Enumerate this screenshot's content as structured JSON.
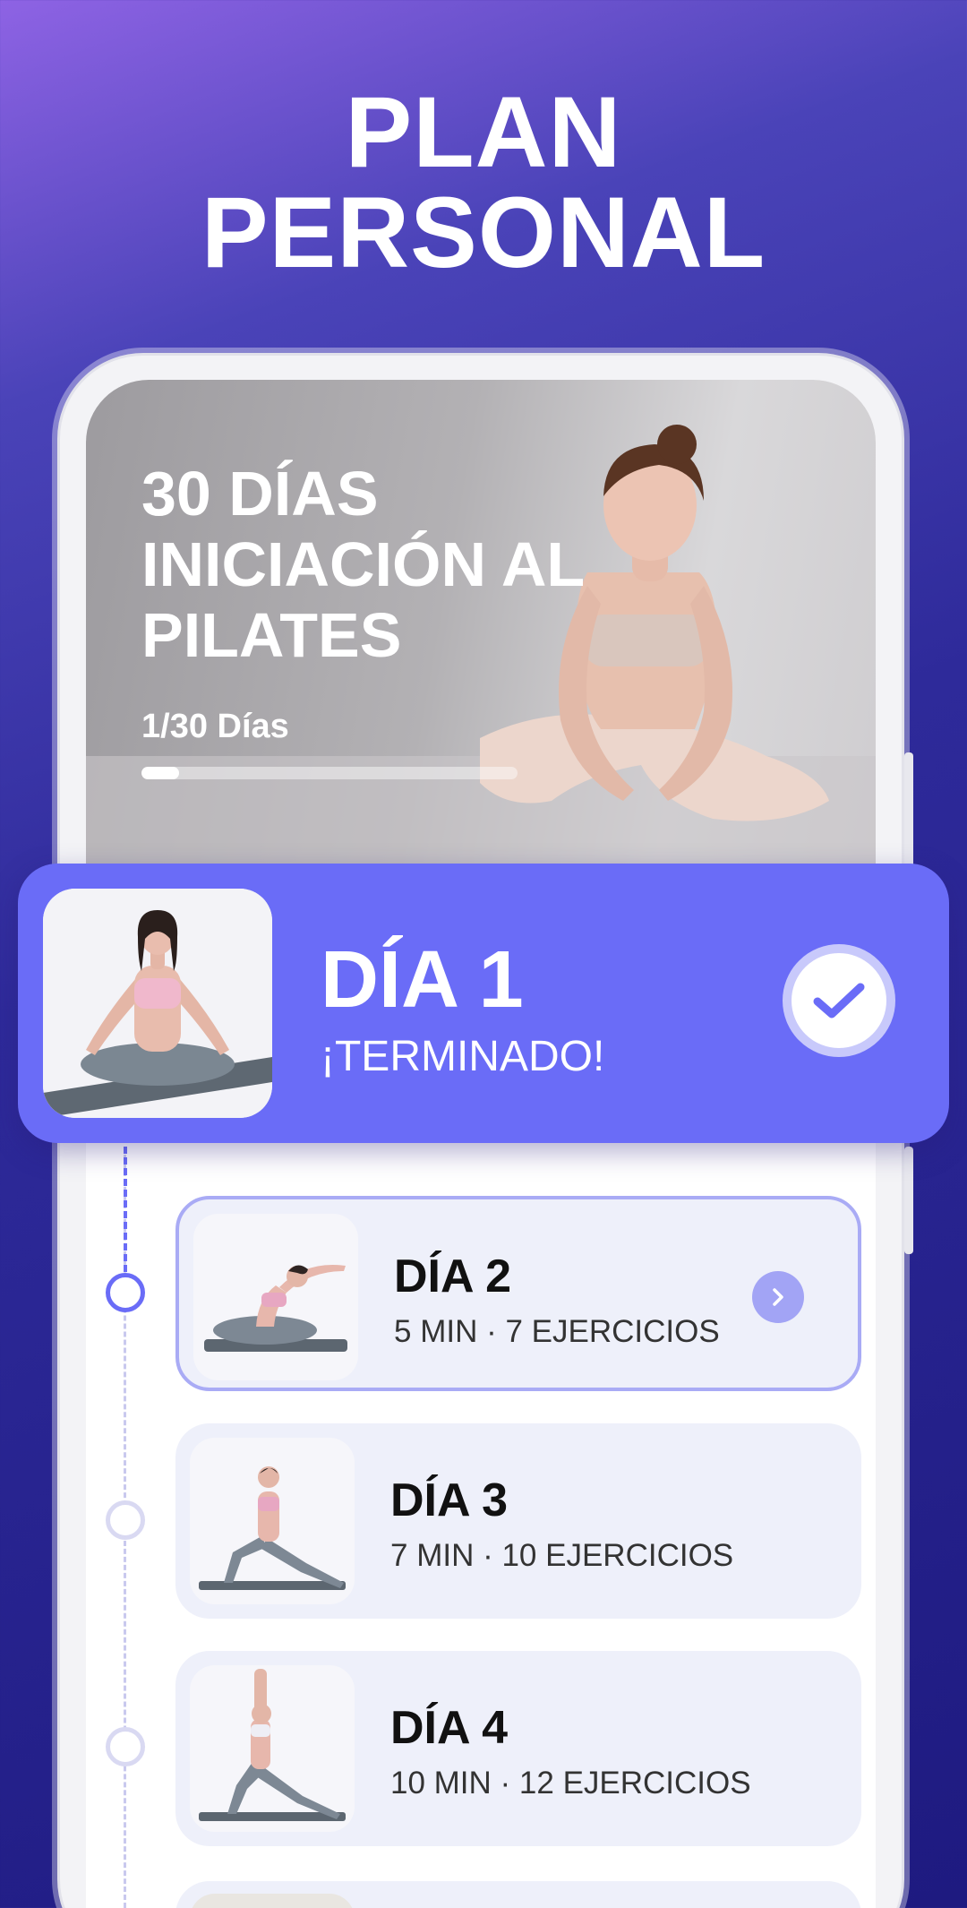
{
  "headline": {
    "line1": "PLAN",
    "line2": "PERSONAL"
  },
  "hero": {
    "title_lines": [
      "30 DÍAS",
      "INICIACIÓN AL",
      "PILATES"
    ],
    "progress_text": "1/30 Días",
    "progress_fraction": 0.1
  },
  "day1": {
    "title": "DÍA 1",
    "status": "¡TERMINADO!",
    "icon": "checkmark-icon"
  },
  "days": [
    {
      "title": "DÍA 2",
      "meta": "5 MIN · 7 EJERCICIOS",
      "active": true
    },
    {
      "title": "DÍA 3",
      "meta": "7 MIN · 10 EJERCICIOS",
      "active": false
    },
    {
      "title": "DÍA 4",
      "meta": "10 MIN · 12 EJERCICIOS",
      "active": false
    }
  ],
  "colors": {
    "accent": "#6a6cf7",
    "background_dark": "#1e1a80",
    "card_bg": "#eef0fa"
  }
}
